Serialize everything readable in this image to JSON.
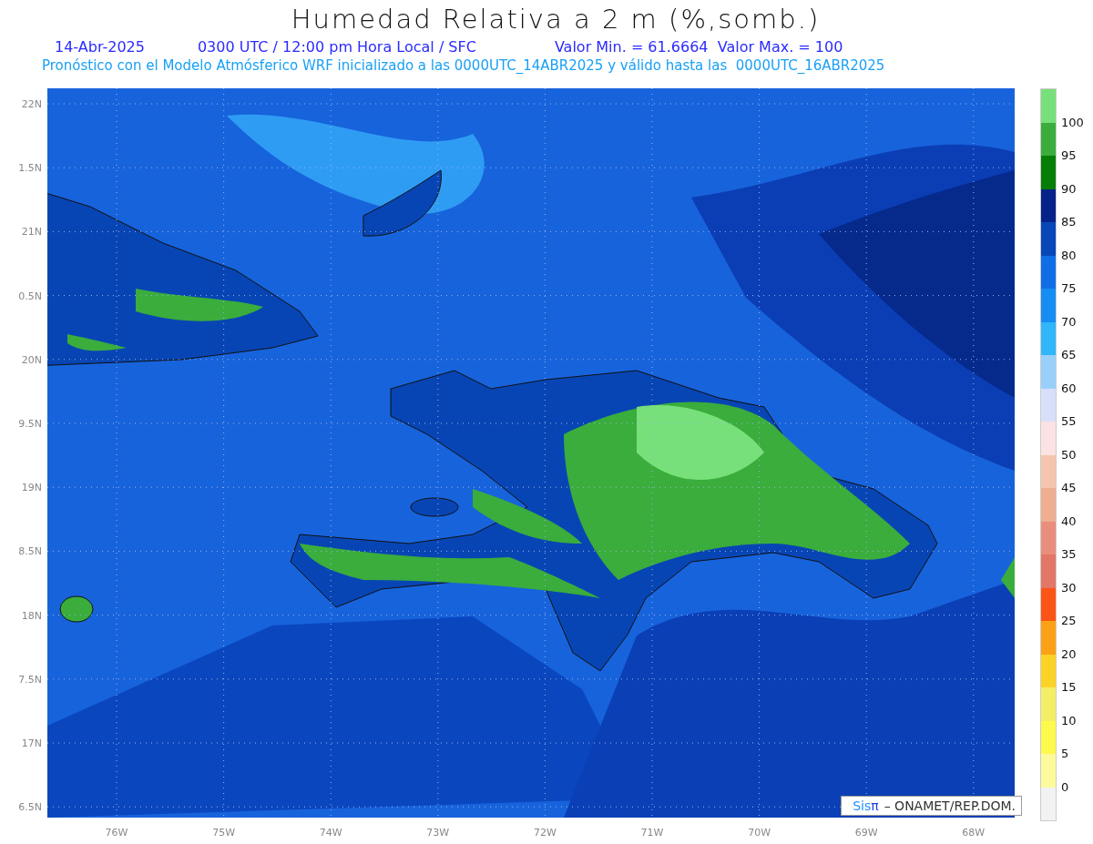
{
  "title": "Humedad Relativa a 2 m (%,somb.)",
  "info": {
    "date": "14-Abr-2025",
    "time": "0300 UTC / 12:00 pm Hora Local / SFC",
    "range": "Valor Min. = 61.6664  Valor Max. = 100"
  },
  "forecast": "Pronóstico con el Modelo Atmósferico WRF inicializado a las 0000UTC_14ABR2025 y válido hasta las  0000UTC_16ABR2025",
  "map": {
    "lat_labels": [
      "22N",
      "1.5N",
      "21N",
      "0.5N",
      "20N",
      "9.5N",
      "19N",
      "8.5N",
      "18N",
      "7.5N",
      "17N",
      "6.5N"
    ],
    "lon_labels": [
      "76W",
      "75W",
      "74W",
      "73W",
      "72W",
      "71W",
      "70W",
      "69W",
      "68W"
    ]
  },
  "legend": {
    "bins": [
      {
        "color": "#77e07a"
      },
      {
        "color": "#3aad3c"
      },
      {
        "color": "#067d06"
      },
      {
        "color": "#06228a"
      },
      {
        "color": "#0747b8"
      },
      {
        "color": "#0f6ee6"
      },
      {
        "color": "#168df2"
      },
      {
        "color": "#2fb6fb"
      },
      {
        "color": "#99d0fb"
      },
      {
        "color": "#d8dffb"
      },
      {
        "color": "#fce2e2"
      },
      {
        "color": "#f5c5ad"
      },
      {
        "color": "#eeae8f"
      },
      {
        "color": "#e98e7c"
      },
      {
        "color": "#e27667"
      },
      {
        "color": "#fc5417"
      },
      {
        "color": "#fba117"
      },
      {
        "color": "#fbd327"
      },
      {
        "color": "#f4ee67"
      },
      {
        "color": "#fdf94d"
      },
      {
        "color": "#fdfa9c"
      },
      {
        "color": "#f2f2f2"
      }
    ],
    "ticks": [
      "100",
      "95",
      "90",
      "85",
      "80",
      "75",
      "70",
      "65",
      "60",
      "55",
      "50",
      "45",
      "40",
      "35",
      "30",
      "25",
      "20",
      "15",
      "10",
      "5",
      "0"
    ]
  },
  "credit": {
    "logo_text": "Sis",
    "logo_mark": "π",
    "text": "– ONAMET/REP.DOM."
  }
}
